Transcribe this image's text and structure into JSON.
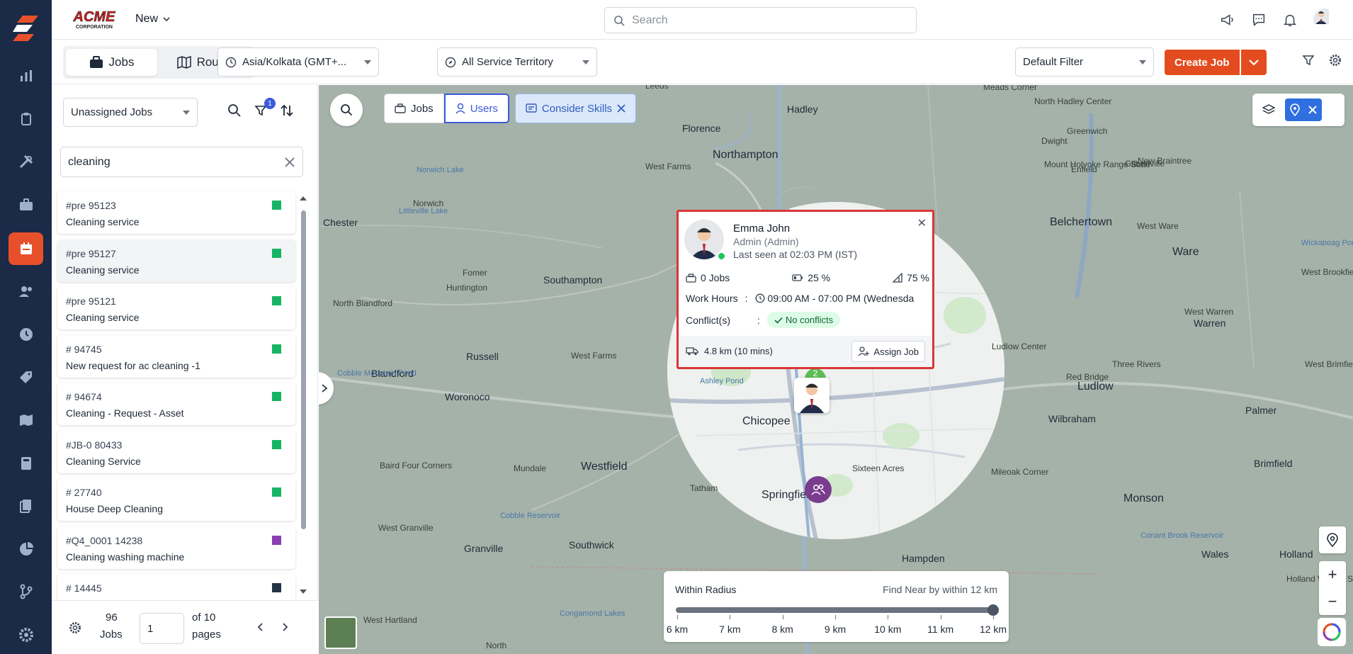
{
  "brand": {
    "name": "ACME CORPORATION",
    "colors": {
      "rail": "#1b2a47",
      "accent": "#e34c1f",
      "primary": "#3b5bdb"
    }
  },
  "header": {
    "new_label": "New",
    "search_placeholder": "Search",
    "icons": [
      "megaphone-icon",
      "chat-icon",
      "bell-icon",
      "user-avatar"
    ]
  },
  "rail": {
    "items": [
      "dashboard-icon",
      "reports-icon",
      "clipboard-icon",
      "tools-icon",
      "briefcase-icon",
      "calendar-icon",
      "users-icon",
      "clock-icon",
      "tag-icon",
      "map-icon",
      "calculator-icon",
      "documents-icon",
      "pie-chart-icon",
      "workflow-icon",
      "settings-icon"
    ],
    "active": "calendar-icon"
  },
  "subbar": {
    "tabs": [
      {
        "label": "Jobs",
        "icon": "briefcase-icon",
        "active": true
      },
      {
        "label": "Routes",
        "icon": "map-icon",
        "active": false
      }
    ],
    "timezone": "Asia/Kolkata (GMT+...",
    "territory": "All Service Territory",
    "filter": "Default Filter",
    "create_job": "Create Job"
  },
  "panel": {
    "queue_select": "Unassigned Jobs",
    "filter_badge": "1",
    "search_value": "cleaning",
    "jobs": [
      {
        "id": "#pre 95123",
        "desc": "Cleaning service",
        "color": "#16b464",
        "selected": false
      },
      {
        "id": "#pre 95127",
        "desc": "Cleaning service",
        "color": "#16b464",
        "selected": true
      },
      {
        "id": "#pre 95121",
        "desc": "Cleaning service",
        "color": "#16b464",
        "selected": false
      },
      {
        "id": "# 94745",
        "desc": "New request for ac cleaning -1",
        "color": "#16b464",
        "selected": false
      },
      {
        "id": "# 94674",
        "desc": "Cleaning - Request - Asset",
        "color": "#16b464",
        "selected": false
      },
      {
        "id": "#JB-0 80433",
        "desc": "Cleaning Service",
        "color": "#16b464",
        "selected": false
      },
      {
        "id": "# 27740",
        "desc": "House Deep Cleaning",
        "color": "#16b464",
        "selected": false
      },
      {
        "id": "#Q4_0001 14238",
        "desc": "Cleaning washing machine",
        "color": "#8b3fb3",
        "selected": false
      },
      {
        "id": "# 14445",
        "desc": "",
        "color": "#243447",
        "selected": false
      }
    ],
    "pager": {
      "count": "96",
      "count_unit": "Jobs",
      "page": "1",
      "of_text": "of 10",
      "pages_text": "pages"
    }
  },
  "map": {
    "pills": {
      "jobs": "Jobs",
      "users": "Users",
      "skills": "Consider Skills"
    },
    "labels": [
      {
        "t": "Leeds"
      },
      {
        "t": "Hadley"
      },
      {
        "t": "Meads Corner"
      },
      {
        "t": "North Hadley Center"
      },
      {
        "t": "Dwight"
      },
      {
        "t": "Greenwich"
      },
      {
        "t": "Florence"
      },
      {
        "t": "Northampton"
      },
      {
        "t": "Gilbertville"
      },
      {
        "t": "New Braintree"
      },
      {
        "t": "West Farms"
      },
      {
        "t": "Mount Holyoke Range State"
      },
      {
        "t": "Enfield"
      },
      {
        "t": "Chester"
      },
      {
        "t": "Norwich Lake"
      },
      {
        "t": "Norwich"
      },
      {
        "t": "Littleville Lake"
      },
      {
        "t": "Belchertown"
      },
      {
        "t": "West Ware"
      },
      {
        "t": "Ware"
      },
      {
        "t": "Southampton"
      },
      {
        "t": "Fomer"
      },
      {
        "t": "Huntington"
      },
      {
        "t": "Wickaboag Pond"
      },
      {
        "t": "West Brookfield"
      },
      {
        "t": "North Blandford"
      },
      {
        "t": "West Warren"
      },
      {
        "t": "Warren"
      },
      {
        "t": "Russell"
      },
      {
        "t": "West Farms"
      },
      {
        "t": "Blandford"
      },
      {
        "t": "Ludlow Center"
      },
      {
        "t": "Cobble Mountain Pond"
      },
      {
        "t": "Three Rivers"
      },
      {
        "t": "West Brimfield"
      },
      {
        "t": "Woronoco"
      },
      {
        "t": "Ashley Pond"
      },
      {
        "t": "Ludlow"
      },
      {
        "t": "Red Bridge"
      },
      {
        "t": "Chicopee"
      },
      {
        "t": "Wilbraham"
      },
      {
        "t": "Palmer"
      },
      {
        "t": "Westfield"
      },
      {
        "t": "Mundale"
      },
      {
        "t": "Baird Four Corners"
      },
      {
        "t": "Tatham"
      },
      {
        "t": "Sixteen Acres"
      },
      {
        "t": "Mileoak Corner"
      },
      {
        "t": "Brimfield"
      },
      {
        "t": "Cobble Reservoir"
      },
      {
        "t": "Springfield"
      },
      {
        "t": "Monson"
      },
      {
        "t": "West Granville"
      },
      {
        "t": "Granville"
      },
      {
        "t": "Southwick"
      },
      {
        "t": "Hampden"
      },
      {
        "t": "Wales"
      },
      {
        "t": "Holland"
      },
      {
        "t": "Conant Brook Reservoir"
      },
      {
        "t": "West Hartland"
      },
      {
        "t": "Congamond Lakes"
      },
      {
        "t": "North"
      },
      {
        "t": "Holland Wildlife Sanctuary"
      }
    ],
    "popup": {
      "name": "Emma John",
      "role": "Admin (Admin)",
      "last_seen": "Last seen at 02:03 PM (IST)",
      "jobs": "0 Jobs",
      "stat2": "25 %",
      "stat3": "75 %",
      "work_hours_label": "Work Hours",
      "work_hours": "09:00 AM - 07:00 PM (Wednesda",
      "conflicts_label": "Conflict(s)",
      "conflicts": "No conflicts",
      "distance": "4.8 km (10 mins)",
      "assign": "Assign Job"
    },
    "cluster": "2",
    "radius": {
      "title": "Within Radius",
      "hint": "Find Near by within 12 km",
      "ticks": [
        "6 km",
        "7 km",
        "8 km",
        "9 km",
        "10 km",
        "11 km",
        "12 km"
      ],
      "value_km": 12
    }
  }
}
